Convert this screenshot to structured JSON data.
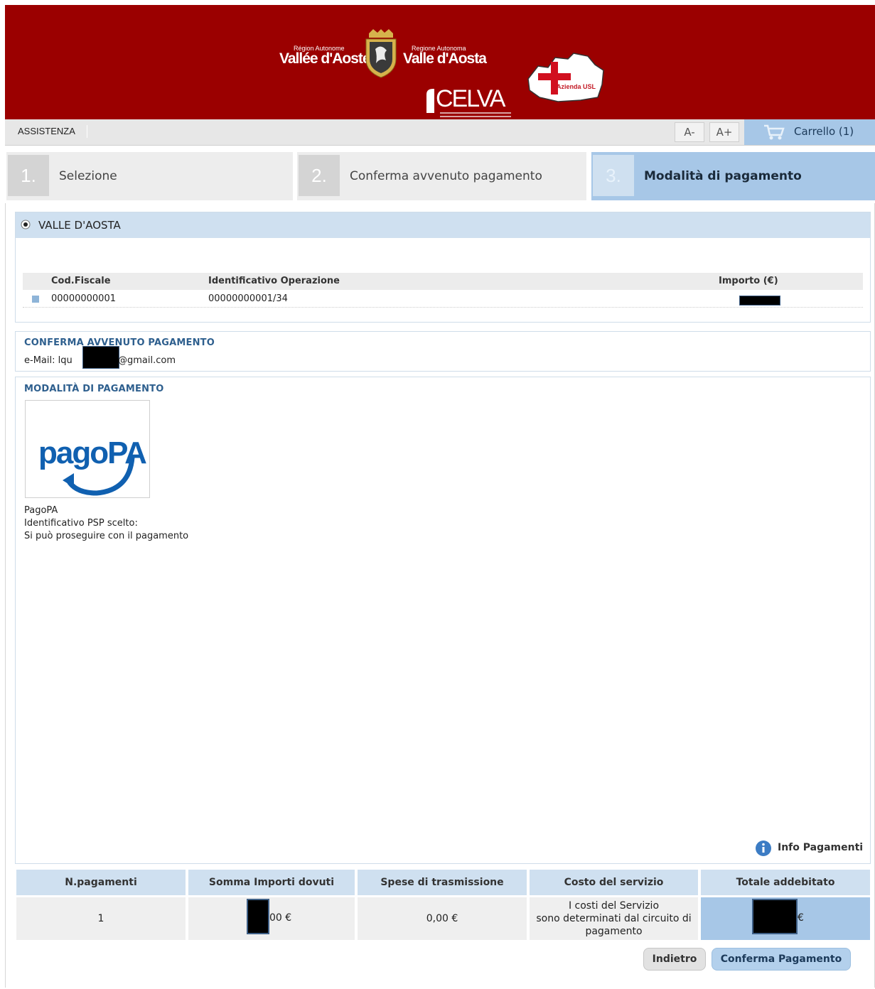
{
  "header": {
    "logo_left_small": "Région Autonome",
    "logo_left_big": "Vallée d'Aoste",
    "logo_right_small": "Regione Autonoma",
    "logo_right_big": "Valle d'Aosta",
    "logo_celva": "CELVA",
    "logo_usl": "Azienda USL"
  },
  "topbar": {
    "assistance": "ASSISTENZA",
    "font_decrease": "A-",
    "font_increase": "A+",
    "cart": "Carrello (1)"
  },
  "steps": [
    {
      "num": "1.",
      "label": "Selezione"
    },
    {
      "num": "2.",
      "label": "Conferma avvenuto pagamento"
    },
    {
      "num": "3.",
      "label": "Modalità di pagamento"
    }
  ],
  "entity": {
    "name": "VALLE D'AOSTA",
    "columns": [
      "Cod.Fiscale",
      "Identificativo Operazione",
      "Importo (€)"
    ],
    "rows": [
      {
        "cod_fiscale": "00000000001",
        "operazione": "00000000001/34"
      }
    ]
  },
  "confirm": {
    "title": "CONFERMA AVVENUTO PAGAMENTO",
    "email_prefix": "e-Mail: lqu",
    "email_suffix": "@gmail.com"
  },
  "payment_method": {
    "title": "MODALITÀ DI PAGAMENTO",
    "logo_text": "pagoPA",
    "name": "PagoPA",
    "psp": "Identificativo PSP scelto:",
    "note": "Si può proseguire con il pagamento",
    "info_link": "Info Pagamenti"
  },
  "summary": {
    "headers": [
      "N.pagamenti",
      "Somma Importi dovuti",
      "Spese di trasmissione",
      "Costo del servizio",
      "Totale addebitato"
    ],
    "n_payments": "1",
    "sum_suffix": "00 €",
    "transmission": "0,00 €",
    "service_cost_1": "I costi del Servizio",
    "service_cost_2": "sono determinati dal circuito di",
    "service_cost_3": "pagamento",
    "total_suffix": "€"
  },
  "buttons": {
    "back": "Indietro",
    "confirm": "Conferma Pagamento"
  },
  "colors": {
    "banner": "#9b0000",
    "accent": "#a7c7e7",
    "section_title": "#2e5f8e"
  }
}
